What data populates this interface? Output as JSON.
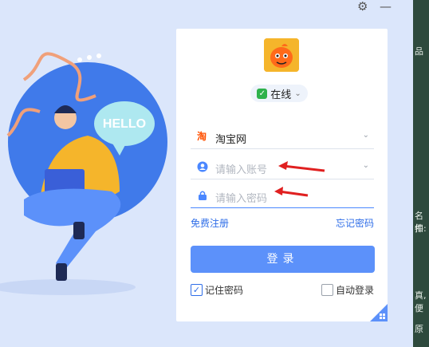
{
  "window": {
    "settings_icon": "gear-icon",
    "minimize_label": "—"
  },
  "status": {
    "label": "在线"
  },
  "account_site": {
    "label": "淘宝网",
    "icon_label": "淘"
  },
  "account_input": {
    "placeholder": "请输入账号"
  },
  "password_input": {
    "placeholder": "请输入密码"
  },
  "links": {
    "register": "免费注册",
    "forgot": "忘记密码"
  },
  "login_button": {
    "label": "登录"
  },
  "remember": {
    "label": "记住密码",
    "checked": true
  },
  "auto_login": {
    "label": "自动登录",
    "checked": false
  },
  "illustration": {
    "bubble_text": "HELLO"
  },
  "background_fragments": [
    "品",
    "名扣",
    "件:",
    "真,",
    "便",
    "原"
  ],
  "colors": {
    "accent": "#5c91fa",
    "link": "#2f6ee8",
    "online": "#2fb24c",
    "annotation_arrow": "#e02020"
  }
}
